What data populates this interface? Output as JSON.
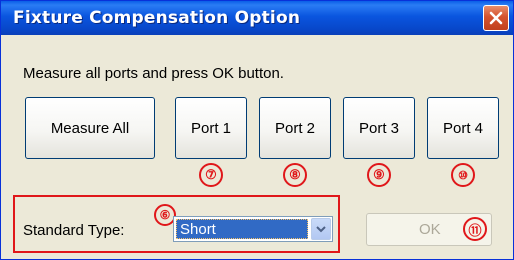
{
  "window": {
    "title": "Fixture Compensation Option",
    "instruction": "Measure all ports and press OK button."
  },
  "buttons": {
    "measure_all": "Measure All",
    "port1": "Port 1",
    "port2": "Port 2",
    "port3": "Port 3",
    "port4": "Port 4",
    "ok": "OK"
  },
  "standard_type": {
    "label": "Standard Type:",
    "selected": "Short"
  },
  "annotations": {
    "n6": "⑥",
    "n7": "⑦",
    "n8": "⑧",
    "n9": "⑨",
    "n10": "⑩",
    "n11": "⑪"
  },
  "icons": {
    "close": "close-icon",
    "dropdown": "chevron-down-icon"
  },
  "colors": {
    "titlebar": "#0a55df",
    "annotation": "#e0171a",
    "selection": "#316ac5"
  }
}
